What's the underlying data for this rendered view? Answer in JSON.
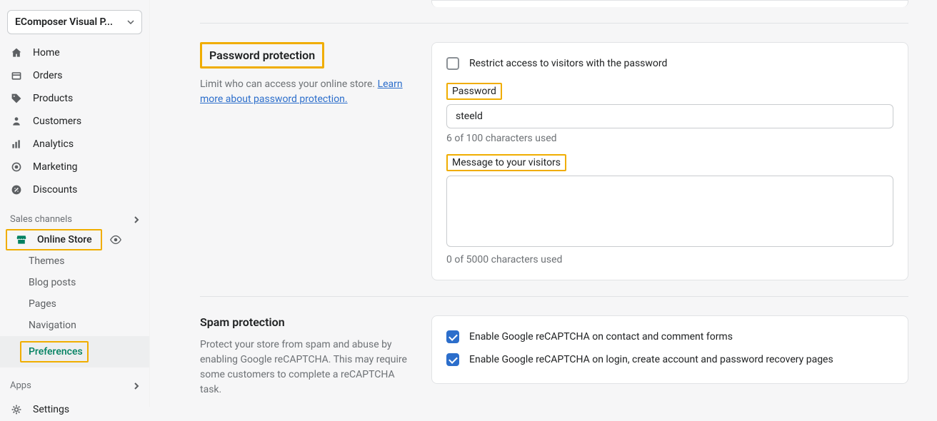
{
  "app_picker": {
    "label": "EComposer Visual P..."
  },
  "nav": {
    "home": "Home",
    "orders": "Orders",
    "products": "Products",
    "customers": "Customers",
    "analytics": "Analytics",
    "marketing": "Marketing",
    "discounts": "Discounts",
    "sales_channels_label": "Sales channels",
    "online_store": "Online Store",
    "sub": {
      "themes": "Themes",
      "blog_posts": "Blog posts",
      "pages": "Pages",
      "navigation": "Navigation",
      "preferences": "Preferences"
    },
    "apps_label": "Apps",
    "settings": "Settings"
  },
  "password_section": {
    "title": "Password protection",
    "desc_prefix": "Limit who can access your online store. ",
    "desc_link": "Learn more about password protection.",
    "restrict_label": "Restrict access to visitors with the password",
    "password_label": "Password",
    "password_value": "steeld",
    "password_hint": "6 of 100 characters used",
    "message_label": "Message to your visitors",
    "message_value": "",
    "message_hint": "0 of 5000 characters used"
  },
  "spam_section": {
    "title": "Spam protection",
    "desc": "Protect your store from spam and abuse by enabling Google reCAPTCHA. This may require some customers to complete a reCAPTCHA task.",
    "opt1": "Enable Google reCAPTCHA on contact and comment forms",
    "opt2": "Enable Google reCAPTCHA on login, create account and password recovery pages"
  }
}
